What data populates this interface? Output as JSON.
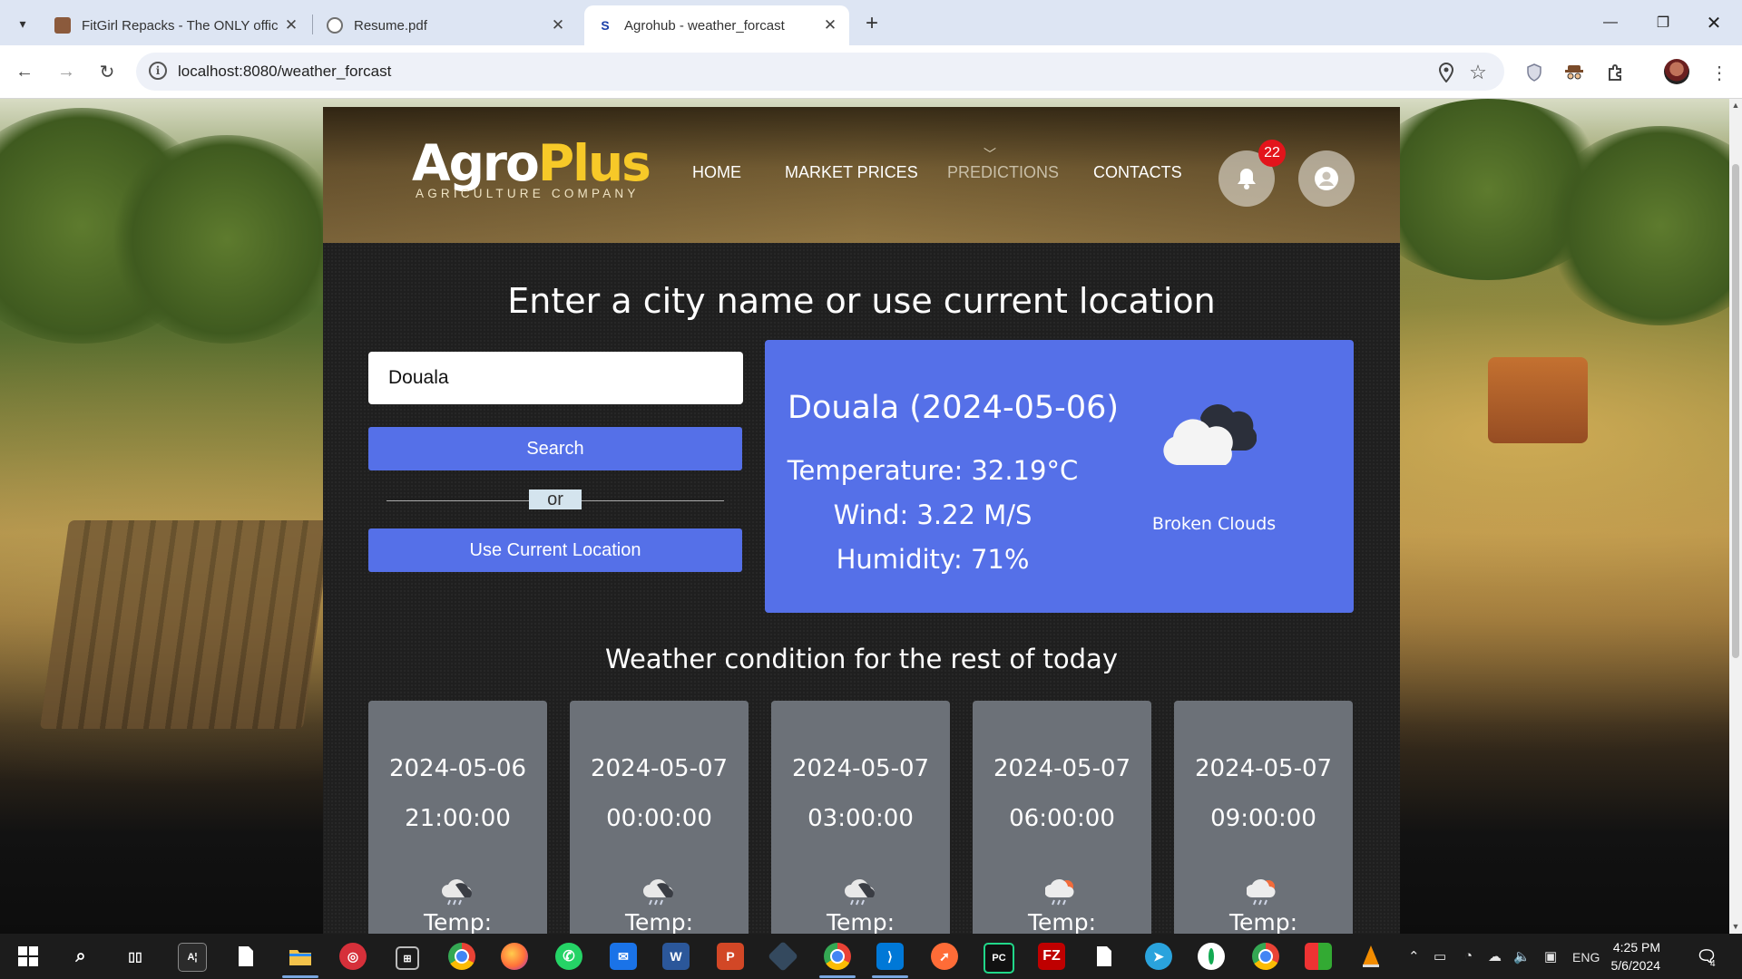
{
  "browser": {
    "tabs": [
      {
        "title": "FitGirl Repacks - The ONLY offic",
        "favicon_color": "#8b5a3c",
        "active": false
      },
      {
        "title": "Resume.pdf",
        "favicon_color": "#707070",
        "active": false
      },
      {
        "title": "Agrohub - weather_forcast",
        "favicon_color": "#1a3fa8",
        "favicon_letter": "S",
        "active": true
      }
    ],
    "url": "localhost:8080/weather_forcast"
  },
  "site": {
    "logo": {
      "part1": "Agro",
      "part2": "Plus",
      "tagline": "AGRICULTURE COMPANY"
    },
    "nav": [
      {
        "label": "HOME"
      },
      {
        "label": "MARKET PRICES"
      },
      {
        "label": "PREDICTIONS"
      },
      {
        "label": "CONTACTS"
      }
    ],
    "notification_count": "22"
  },
  "search": {
    "heading": "Enter a city name or use current location",
    "city_value": "Douala",
    "search_label": "Search",
    "or_label": "or",
    "location_label": "Use Current Location"
  },
  "current": {
    "title": "Douala (2024-05-06)",
    "temperature": "Temperature: 32.19°C",
    "wind": "Wind: 3.22 M/S",
    "humidity": "Humidity: 71%",
    "description": "Broken Clouds"
  },
  "forecast": {
    "heading": "Weather condition for the rest of today",
    "items": [
      {
        "date": "2024-05-06",
        "time": "21:00:00",
        "temp_label": "Temp:",
        "icon": "rain-cloud-icon"
      },
      {
        "date": "2024-05-07",
        "time": "00:00:00",
        "temp_label": "Temp:",
        "icon": "rain-cloud-icon"
      },
      {
        "date": "2024-05-07",
        "time": "03:00:00",
        "temp_label": "Temp:",
        "icon": "rain-cloud-icon"
      },
      {
        "date": "2024-05-07",
        "time": "06:00:00",
        "temp_label": "Temp:",
        "icon": "sun-rain-cloud-icon"
      },
      {
        "date": "2024-05-07",
        "time": "09:00:00",
        "temp_label": "Temp:",
        "icon": "sun-rain-cloud-icon"
      }
    ]
  },
  "taskbar": {
    "language": "ENG",
    "time": "4:25 PM",
    "date": "5/6/2024",
    "notif_count": "4"
  },
  "colors": {
    "accent": "#5570e8",
    "badge": "#e3141b",
    "logo_plus": "#f7c928"
  }
}
